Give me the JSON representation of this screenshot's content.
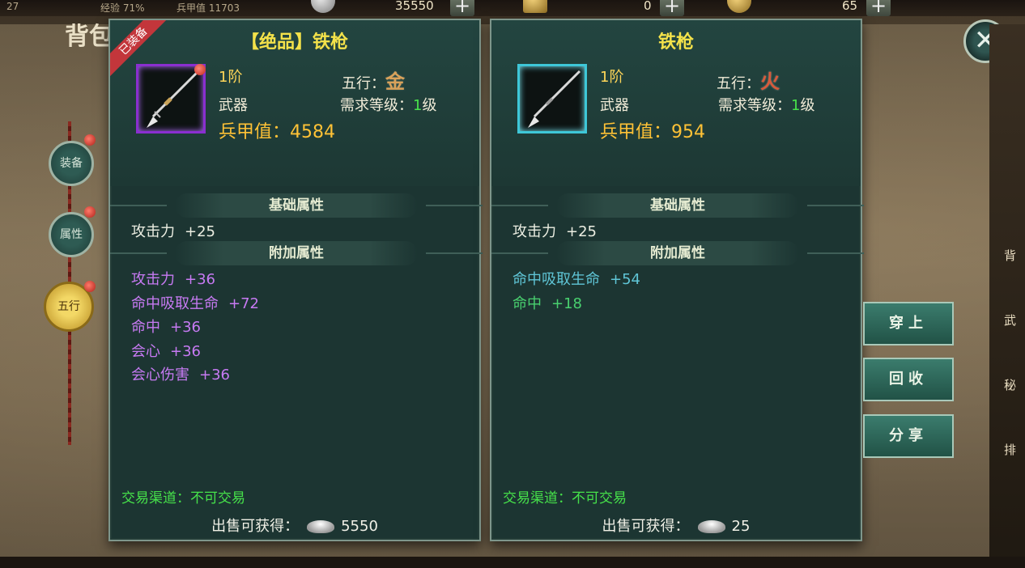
{
  "topbar": {
    "level_text": "27",
    "exp_text": "经验 71%",
    "power_text": "兵甲值 11703",
    "silver_amount": "35550",
    "ticket_amount": "0",
    "gold_amount": "65"
  },
  "bag_title": "背包",
  "side_tabs": [
    "装备",
    "属性",
    "五行"
  ],
  "right_strip": [
    "背",
    "武",
    "秘",
    "排"
  ],
  "left_panel": {
    "badge": "已装备",
    "title": "【绝品】铁枪",
    "tier": "1阶",
    "type": "武器",
    "wuxing_label": "五行：",
    "wuxing_char": "金",
    "req_label": "需求等级：",
    "req_value": "1",
    "req_unit": "级",
    "power_label": "兵甲值：",
    "power_value": "4584",
    "base_title": "基础属性",
    "base_stats": [
      {
        "name": "攻击力",
        "value": "+25"
      }
    ],
    "extra_title": "附加属性",
    "extra_stats": [
      {
        "name": "攻击力",
        "value": "+36"
      },
      {
        "name": "命中吸取生命",
        "value": "+72"
      },
      {
        "name": "命中",
        "value": "+36"
      },
      {
        "name": "会心",
        "value": "+36"
      },
      {
        "name": "会心伤害",
        "value": "+36"
      }
    ],
    "trade": "交易渠道：不可交易",
    "sell_label": "出售可获得：",
    "sell_value": "5550"
  },
  "right_panel": {
    "title": "铁枪",
    "tier": "1阶",
    "type": "武器",
    "wuxing_label": "五行：",
    "wuxing_char": "火",
    "req_label": "需求等级：",
    "req_value": "1",
    "req_unit": "级",
    "power_label": "兵甲值：",
    "power_value": "954",
    "base_title": "基础属性",
    "base_stats": [
      {
        "name": "攻击力",
        "value": "+25"
      }
    ],
    "extra_title": "附加属性",
    "extra_stats": [
      {
        "name": "命中吸取生命",
        "value": "+54"
      },
      {
        "name": "命中",
        "value": "+18"
      }
    ],
    "trade": "交易渠道：不可交易",
    "sell_label": "出售可获得：",
    "sell_value": "25"
  },
  "actions": {
    "equip": "穿上",
    "recycle": "回收",
    "share": "分享"
  },
  "colors": {
    "title_gold": "#f4e24a",
    "power_orange": "#ffc236",
    "purple_stat": "#c77af3",
    "cyan_stat": "#5fc5d6",
    "green_stat": "#49d06f",
    "trade_green": "#46e24a"
  },
  "icons": {
    "close": "close-icon",
    "weapon": "spear-icon",
    "silver": "silver-ingot-icon"
  }
}
